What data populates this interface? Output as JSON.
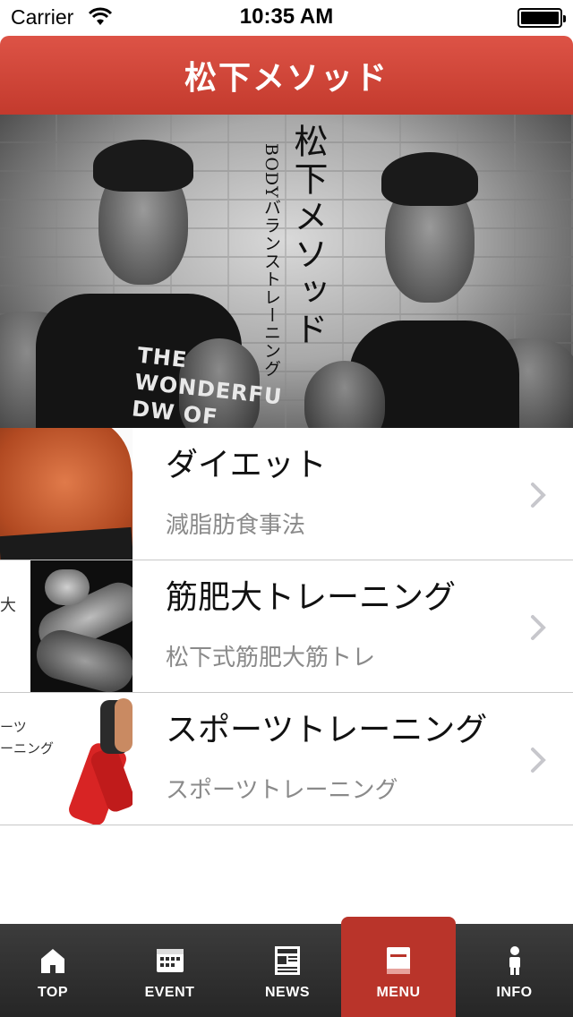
{
  "status_bar": {
    "carrier": "Carrier",
    "time": "10:35 AM"
  },
  "nav": {
    "title": "松下メソッド",
    "accent_color": "#cf4336"
  },
  "hero": {
    "title": "松下メソッド",
    "subtitle": "BODYバランストレーニング",
    "shirt_text": [
      "THE",
      "WONDERFU",
      "DW OF"
    ]
  },
  "menu_items": [
    {
      "title": "ダイエット",
      "subtitle": "減脂肪食事法",
      "thumb_text": ""
    },
    {
      "title": "筋肥大トレーニング",
      "subtitle": "松下式筋肥大筋トレ",
      "thumb_text": "大"
    },
    {
      "title": "スポーツトレーニング",
      "subtitle": "スポーツトレーニング",
      "thumb_text": "ーツ\nーニング"
    }
  ],
  "tabs": [
    {
      "label": "TOP",
      "icon": "home-icon",
      "active": false
    },
    {
      "label": "EVENT",
      "icon": "calendar-icon",
      "active": false
    },
    {
      "label": "NEWS",
      "icon": "newspaper-icon",
      "active": false
    },
    {
      "label": "MENU",
      "icon": "menu-book-icon",
      "active": true
    },
    {
      "label": "INFO",
      "icon": "info-person-icon",
      "active": false
    }
  ],
  "colors": {
    "tab_bar": "#2e2e2e",
    "tab_active": "#b9342a"
  }
}
